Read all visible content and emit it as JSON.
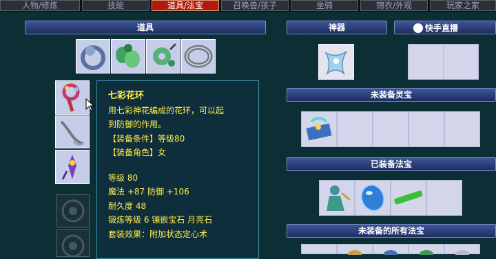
{
  "tabs": [
    "人物/修炼",
    "技能",
    "道具/法宝",
    "召唤兽/孩子",
    "坐骑",
    "锦衣/外观",
    "玩家之家"
  ],
  "active_tab_index": 2,
  "sections": {
    "items": "道具",
    "artifact": "神器",
    "unequipped_spirit": "未装备灵宝",
    "equipped_fabao": "已装备法宝",
    "unequipped_all_fabao": "未装备的所有法宝"
  },
  "item_icons": [
    "bracelet-icon",
    "jade-flower-icon",
    "jade-pendant-icon",
    "silver-ring-icon"
  ],
  "equip_icons": [
    "flower-wreath-icon",
    "silver-hook-icon",
    "purple-charm-icon"
  ],
  "tooltip": {
    "name": "七彩花环",
    "desc1": "用七彩神花编成的花环，可以起",
    "desc2": "到防御的作用。",
    "req_level": "【装备条件】等级80",
    "req_role": "【装备角色】女",
    "level": "等级 80",
    "stats": "魔法 +87 防御 +106",
    "durability": "耐久度 48",
    "refine": "锻炼等级 6 镶嵌宝石 月亮石",
    "effect": "套装效果：附加状态定心术"
  },
  "watermark": "快手直播",
  "colors": {
    "tooltip_text": "#ffef4a",
    "active_tab": "#b01a12",
    "header": "#2a3f7e"
  }
}
